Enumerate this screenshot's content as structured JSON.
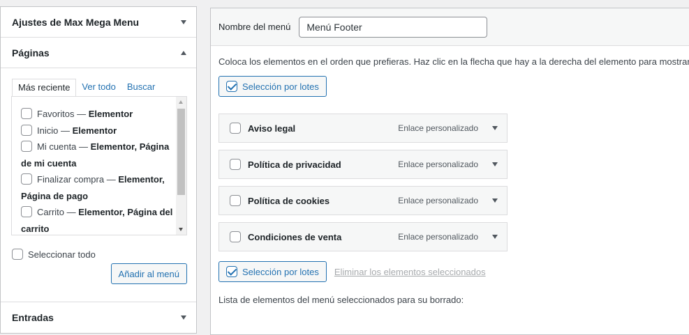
{
  "left": {
    "max_mega_menu_title": "Ajustes de Max Mega Menu",
    "pages": {
      "title": "Páginas",
      "tabs": [
        "Más reciente",
        "Ver todo",
        "Buscar"
      ],
      "items": [
        {
          "name": "Favoritos",
          "sep": " — ",
          "tag": "Elementor"
        },
        {
          "name": "Inicio",
          "sep": " — ",
          "tag": "Elementor"
        },
        {
          "name": "Mi cuenta",
          "sep": " — ",
          "tag": "Elementor, Página de mi cuenta"
        },
        {
          "name": "Finalizar compra",
          "sep": " — ",
          "tag": "Elementor, Página de pago"
        },
        {
          "name": "Carrito",
          "sep": " — ",
          "tag": "Elementor, Página del carrito"
        }
      ],
      "select_all_label": "Seleccionar todo",
      "add_button": "Añadir al menú"
    },
    "posts_title": "Entradas"
  },
  "menu": {
    "name_label": "Nombre del menú",
    "name_value": "Menú Footer",
    "instructions": "Coloca los elementos en el orden que prefieras. Haz clic en la flecha que hay a la derecha del elemento para mostrar o",
    "bulk_select_label": "Selección por lotes",
    "items": [
      {
        "title": "Aviso legal",
        "type": "Enlace personalizado"
      },
      {
        "title": "Política de privacidad",
        "type": "Enlace personalizado"
      },
      {
        "title": "Política de cookies",
        "type": "Enlace personalizado"
      },
      {
        "title": "Condiciones de venta",
        "type": "Enlace personalizado"
      }
    ],
    "delete_selected_label": "Eliminar los elementos seleccionados",
    "pending_removal_label": "Lista de elementos del menú seleccionados para su borrado:"
  },
  "colors": {
    "accent": "#2271b1",
    "panel_border": "#c3c4c7",
    "background": "#f0f0f1"
  }
}
